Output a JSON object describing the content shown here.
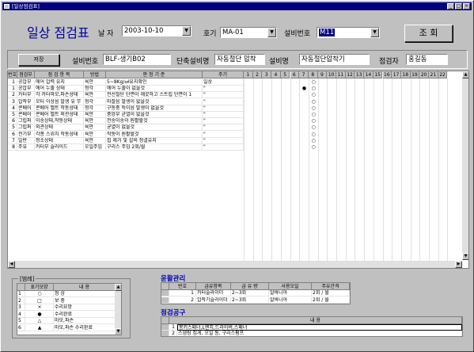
{
  "window": {
    "title": "[일상점검표]"
  },
  "header": {
    "title": "일상 점검표",
    "date_label": "날 자",
    "date_value": "2003-10-10",
    "unit_label": "호기",
    "unit_value": "MA-01",
    "equip_no_label": "설비번호",
    "equip_no_value": "M11",
    "query_button": "조 회"
  },
  "info": {
    "save_button": "저장",
    "equip_no_label": "설비번호",
    "equip_no_value": "BLF-생기B02",
    "line_label": "단축설비명",
    "line_value": "자동절단 압착",
    "name_label": "설비명",
    "name_value": "자동절단압착기",
    "inspector_label": "점검자",
    "inspector_value": "홍길동"
  },
  "grid": {
    "headers": [
      "번호",
      "점검부",
      "점 검 항 목",
      "방법",
      "판 정 기 준",
      "주기"
    ],
    "days": [
      "1",
      "2",
      "3",
      "4",
      "5",
      "6",
      "7",
      "8",
      "9",
      "10",
      "11",
      "12",
      "13",
      "14",
      "15",
      "16",
      "17",
      "18",
      "19",
      "20",
      "21",
      "22"
    ],
    "rows": [
      [
        "1",
        "공압부",
        "에어 압력 유지",
        "육안",
        "5~8Kg/㎠유지확인",
        "일상"
      ],
      [
        "1",
        "공압부",
        "에어 누출 상태",
        "청각",
        "에어 누출이 없을것",
        "\""
      ],
      [
        "2",
        "카터부",
        "각 카터마모,파손상태",
        "육안",
        "전선절단 단면이 깨끗하고 스트립 단면이 1",
        "\""
      ],
      [
        "3",
        "압착부",
        "모터 이상음 발생 유 무",
        "청각",
        "마찰음 발생이 없을것",
        "\""
      ],
      [
        "4",
        "콘베어",
        "콘베어 벨트 작동상태",
        "청각",
        "구동중 특이음 발생이 없을것",
        "\""
      ],
      [
        "5",
        "콘베어",
        "콘베어 벨트 외관상태",
        "육안",
        "중앙부 균열이 없을것",
        "\""
      ],
      [
        "6",
        "그립퍼",
        "이송상태,작동상태",
        "육안",
        "전송이송이 원활할것",
        "\""
      ],
      [
        "5",
        "그립퍼",
        "외관상태",
        "육안",
        "균열이 없을것",
        "\""
      ],
      [
        "6",
        "전기부",
        "각종 스위치 작동상태",
        "육안",
        "작동이 원활할것",
        "\""
      ],
      [
        "7",
        "일반",
        "청소상태",
        "육안",
        "칩 제거 및 설비 청결유지",
        "\""
      ],
      [
        "8",
        "주유",
        "카터부 슬라이드",
        "오일주입",
        "구리스 주입 2회/월",
        "\""
      ]
    ],
    "marks": [
      {
        "row": 1,
        "day": 7,
        "symbol": "●"
      },
      {
        "row": 0,
        "day": 8,
        "symbol": "○"
      },
      {
        "row": 1,
        "day": 8,
        "symbol": "○"
      },
      {
        "row": 2,
        "day": 8,
        "symbol": "○"
      },
      {
        "row": 3,
        "day": 8,
        "symbol": "○"
      },
      {
        "row": 4,
        "day": 8,
        "symbol": "○"
      },
      {
        "row": 5,
        "day": 8,
        "symbol": "○"
      },
      {
        "row": 6,
        "day": 8,
        "symbol": "○"
      },
      {
        "row": 7,
        "day": 8,
        "symbol": "○"
      },
      {
        "row": 8,
        "day": 8,
        "symbol": "○"
      },
      {
        "row": 9,
        "day": 8,
        "symbol": "○"
      },
      {
        "row": 10,
        "day": 8,
        "symbol": "○"
      }
    ]
  },
  "legend": {
    "title": "범례",
    "headers": [
      "표기모양",
      "내 용"
    ],
    "rows": [
      [
        "1",
        "○",
        "정 상"
      ],
      [
        "2",
        "□",
        "보 충"
      ],
      [
        "3",
        "×",
        "수리요망"
      ],
      [
        "4",
        "●",
        "수리완료"
      ],
      [
        "5",
        "△",
        "마모,파손"
      ],
      [
        "6",
        "▲",
        "마모,파손 수리완료"
      ]
    ]
  },
  "lube": {
    "title": "윤활관리",
    "headers": [
      "번호",
      "급유항목",
      "급 유 량",
      "사용오일",
      "주유간격"
    ],
    "rows": [
      [
        "1",
        "카터슬라이더",
        "2~3회",
        "알바니아",
        "2회 / 월"
      ],
      [
        "2",
        "압착기슬라이더",
        "2~3회",
        "알바니아",
        "2회 / 월"
      ]
    ]
  },
  "tools": {
    "title": "점검공구",
    "header": "내 용",
    "rows": [
      [
        "1",
        "몽키스패너,L렌치,드라이버,스패너"
      ],
      [
        "2",
        "스냅링 집게, 오일 통, 구리스펌프"
      ]
    ]
  }
}
